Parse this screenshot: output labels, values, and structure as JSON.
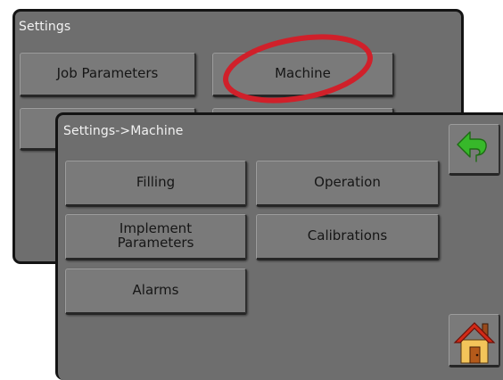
{
  "settings_screen": {
    "title": "Settings",
    "buttons": [
      "Job Parameters",
      "Machine"
    ]
  },
  "machine_screen": {
    "title": "Settings->Machine",
    "buttons": [
      "Filling",
      "Operation",
      "Implement\nParameters",
      "Calibrations",
      "Alarms"
    ]
  },
  "icons": {
    "back": "back-arrow-icon",
    "home": "home-icon",
    "highlight": "red-ellipse-annotation"
  },
  "colors": {
    "panel": "#6e6e6e",
    "button": "#7a7a7a",
    "annotation": "#d0202a",
    "back_arrow": "#37b82a",
    "home_roof": "#d22a17"
  }
}
